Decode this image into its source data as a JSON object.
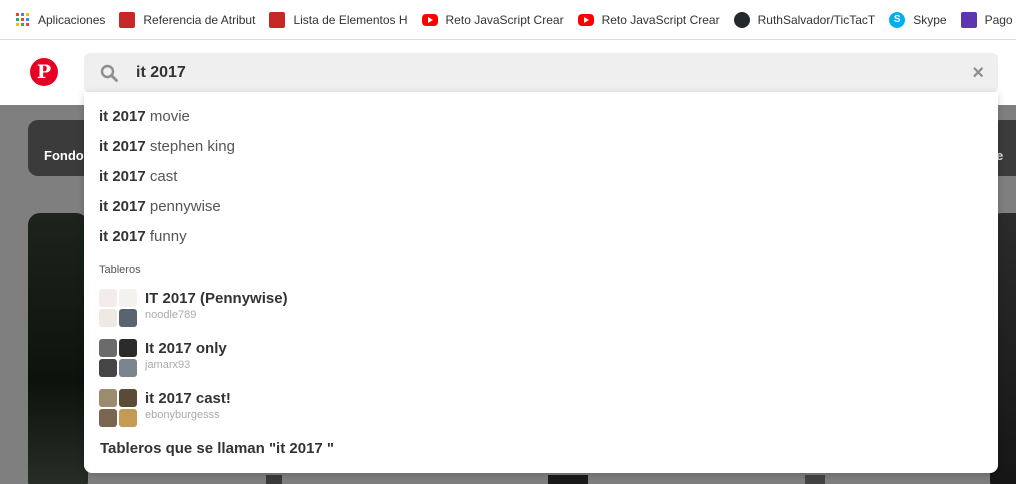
{
  "bookmarks": [
    {
      "label": "Aplicaciones",
      "icon": "apps-grid-icon"
    },
    {
      "label": "Referencia de Atribut",
      "icon": "bookmark-favicon-icon"
    },
    {
      "label": "Lista de Elementos H",
      "icon": "bookmark-favicon-icon"
    },
    {
      "label": "Reto JavaScript Crear",
      "icon": "youtube-icon"
    },
    {
      "label": "Reto JavaScript Crear",
      "icon": "youtube-icon"
    },
    {
      "label": "RuthSalvador/TicTacT",
      "icon": "github-icon"
    },
    {
      "label": "Skype",
      "icon": "skype-icon"
    },
    {
      "label": "Pago mer",
      "icon": "list-icon"
    }
  ],
  "header": {
    "logo_letter": "P",
    "search_value": "it 2017",
    "clear_glyph": "×"
  },
  "background": {
    "pill_left": "Fondo",
    "pill_right": "e"
  },
  "dropdown": {
    "suggestions": [
      {
        "bold": "it 2017",
        "rest": " movie"
      },
      {
        "bold": "it 2017",
        "rest": " stephen king"
      },
      {
        "bold": "it 2017",
        "rest": " cast"
      },
      {
        "bold": "it 2017",
        "rest": " pennywise"
      },
      {
        "bold": "it 2017",
        "rest": " funny"
      }
    ],
    "section_label": "Tableros",
    "boards": [
      {
        "title": "IT 2017 (Pennywise)",
        "user": "noodle789",
        "thumb_colors": [
          "#f2ecec",
          "#f4f2ee",
          "#efe9e3",
          "#5a6470"
        ]
      },
      {
        "title": "It 2017 only",
        "user": "jamarx93",
        "thumb_colors": [
          "#6b6b6b",
          "#2b2b2b",
          "#454545",
          "#7a8590"
        ]
      },
      {
        "title": "it 2017 cast!",
        "user": "ebonyburgesss",
        "thumb_colors": [
          "#9c8c6e",
          "#5a4a38",
          "#7a6650",
          "#c49a55"
        ]
      }
    ],
    "all_boards_label": "Tableros que se llaman \"it 2017 \""
  },
  "colors": {
    "brand": "#e60023",
    "search_bg": "#efefef",
    "overlay": "#7f7f7f"
  }
}
